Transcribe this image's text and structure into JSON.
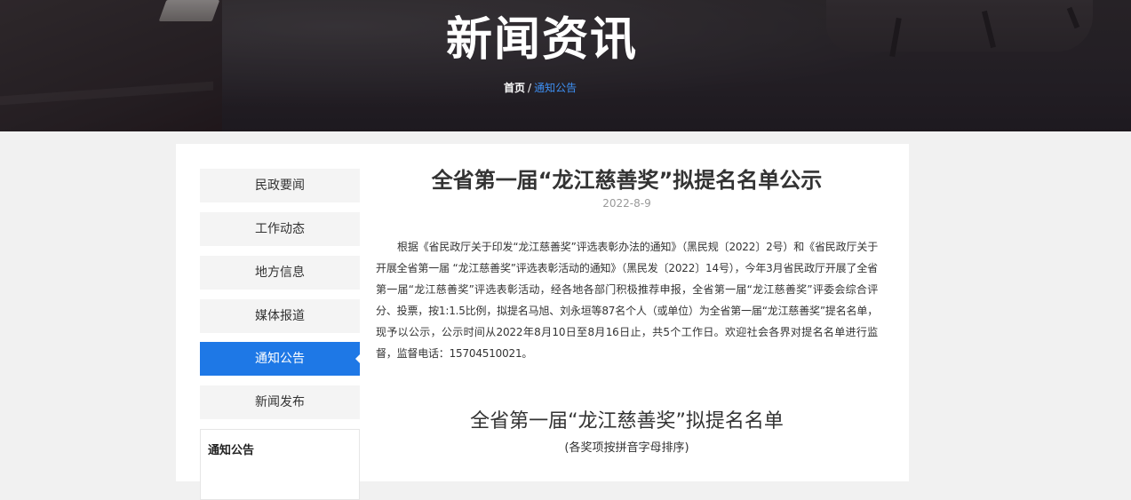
{
  "banner": {
    "title": "新闻资讯",
    "breadcrumb": {
      "home": "首页",
      "separator": "/",
      "current": "通知公告"
    }
  },
  "sidebar": {
    "items": [
      {
        "label": "民政要闻",
        "active": false
      },
      {
        "label": "工作动态",
        "active": false
      },
      {
        "label": "地方信息",
        "active": false
      },
      {
        "label": "媒体报道",
        "active": false
      },
      {
        "label": "通知公告",
        "active": true
      },
      {
        "label": "新闻发布",
        "active": false
      }
    ],
    "box_title": "通知公告"
  },
  "article": {
    "title": "全省第一届“龙江慈善奖”拟提名名单公示",
    "date": "2022-8-9",
    "body": "根据《省民政厅关于印发“龙江慈善奖”评选表彰办法的通知》（黑民规〔2022〕2号）和《省民政厅关于开展全省第一届 “龙江慈善奖”评选表彰活动的通知》（黑民发〔2022〕14号），今年3月省民政厅开展了全省第一届“龙江慈善奖”评选表彰活动，经各地各部门积极推荐申报，全省第一届“龙江慈善奖”评委会综合评分、投票，按1:1.5比例，拟提名马旭、刘永垣等87名个人（或单位）为全省第一届“龙江慈善奖”提名名单，现予以公示，公示时间从2022年8月10日至8月16日止，共5个工作日。欢迎社会各界对提名名单进行监督，监督电话：15704510021。",
    "list_title": "全省第一届“龙江慈善奖”拟提名名单",
    "list_note": "(各奖项按拼音字母排序)"
  },
  "colors": {
    "accent": "#1e78e6",
    "breadcrumb_current": "#3d8ff2",
    "page_bg": "#f1f1f1",
    "banner_bg": "#2b2529"
  }
}
